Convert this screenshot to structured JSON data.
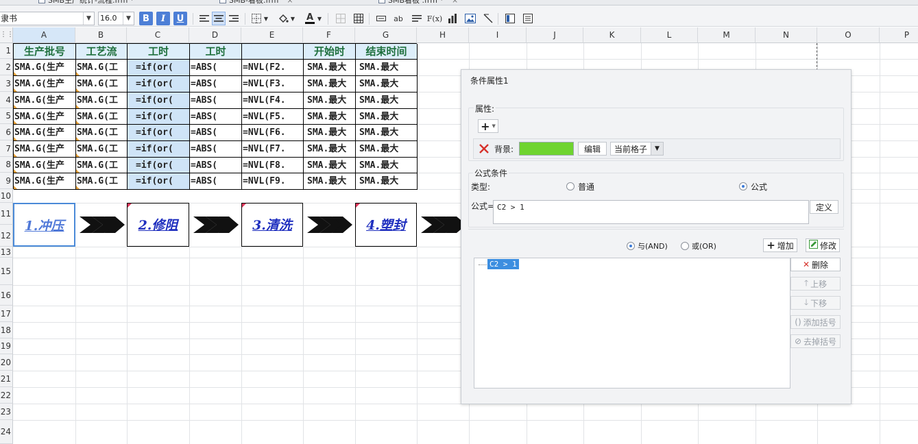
{
  "tabs": [
    {
      "label": "SMB生产统计-流程.frm *"
    },
    {
      "label": "SMB-看板.frm"
    },
    {
      "label": "SMB看板 .frm *"
    }
  ],
  "toolbar": {
    "font_name": "隶书",
    "font_size": "16.0",
    "bold": "B",
    "italic": "I",
    "underline": "U",
    "font_color_glyph": "A"
  },
  "columns": [
    "A",
    "B",
    "C",
    "D",
    "E",
    "F",
    "G",
    "H",
    "I",
    "J",
    "K",
    "L",
    "M",
    "N",
    "O",
    "P"
  ],
  "rows": [
    "1",
    "2",
    "3",
    "4",
    "5",
    "6",
    "7",
    "8",
    "9",
    "10",
    "11",
    "12",
    "13",
    "15",
    "16",
    "17",
    "18",
    "19",
    "20",
    "21",
    "22",
    "23",
    "24"
  ],
  "header_row": [
    "生产批号",
    "工艺流",
    "工时",
    "工时",
    "",
    "开始时",
    "结束时间"
  ],
  "data_rows": [
    [
      "SMA.G(生产",
      "SMA.G(工",
      "=if(or(",
      "=ABS(",
      "=NVL(F2.",
      "SMA.最大",
      "SMA.最大"
    ],
    [
      "SMA.G(生产",
      "SMA.G(工",
      "=if(or(",
      "=ABS(",
      "=NVL(F3.",
      "SMA.最大",
      "SMA.最大"
    ],
    [
      "SMA.G(生产",
      "SMA.G(工",
      "=if(or(",
      "=ABS(",
      "=NVL(F4.",
      "SMA.最大",
      "SMA.最大"
    ],
    [
      "SMA.G(生产",
      "SMA.G(工",
      "=if(or(",
      "=ABS(",
      "=NVL(F5.",
      "SMA.最大",
      "SMA.最大"
    ],
    [
      "SMA.G(生产",
      "SMA.G(工",
      "=if(or(",
      "=ABS(",
      "=NVL(F6.",
      "SMA.最大",
      "SMA.最大"
    ],
    [
      "SMA.G(生产",
      "SMA.G(工",
      "=if(or(",
      "=ABS(",
      "=NVL(F7.",
      "SMA.最大",
      "SMA.最大"
    ],
    [
      "SMA.G(生产",
      "SMA.G(工",
      "=if(or(",
      "=ABS(",
      "=NVL(F8.",
      "SMA.最大",
      "SMA.最大"
    ],
    [
      "SMA.G(生产",
      "SMA.G(工",
      "=if(or(",
      "=ABS(",
      "=NVL(F9.",
      "SMA.最大",
      "SMA.最大"
    ]
  ],
  "process_steps": [
    "1.冲压",
    "2.修阻",
    "3.清洗",
    "4.塑封"
  ],
  "dialog": {
    "title": "条件属性1",
    "attributes_label": "属性:",
    "add_symbol": "+",
    "background_label": "背景:",
    "background_color": "#6fd42f",
    "edit_button": "编辑",
    "scope_value": "当前格子",
    "formula_section": "公式条件",
    "type_label": "类型:",
    "type_normal": "普通",
    "type_formula": "公式",
    "formula_label": "公式=",
    "formula_value": "C2 > 1",
    "define_button": "定义",
    "and_label": "与(AND)",
    "or_label": "或(OR)",
    "add_button": "增加",
    "modify_button": "修改",
    "condition_item": "C2 > 1",
    "delete_button": "删除",
    "move_up_button": "上移",
    "move_down_button": "下移",
    "add_bracket_button": "添加括号",
    "remove_bracket_button": "去掉括号"
  },
  "colors": {
    "header_bg": "#ddeefa",
    "header_text": "#1e6f3c",
    "step_text": "#1f2fbf",
    "selection_bg": "#3c8ee0"
  }
}
